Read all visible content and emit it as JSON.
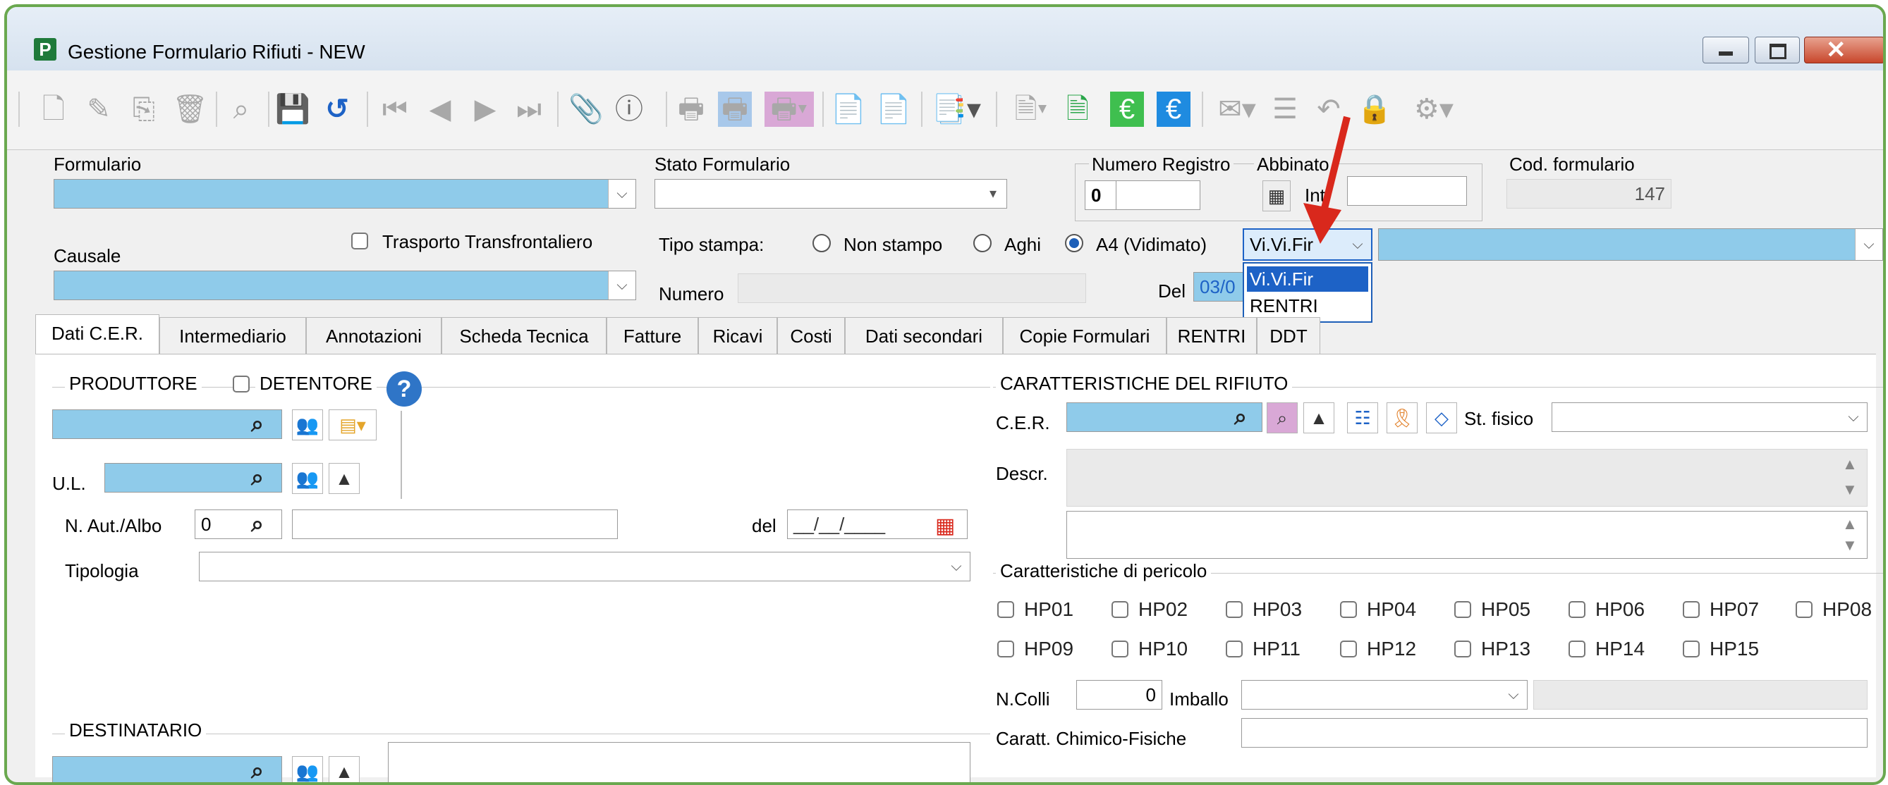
{
  "window": {
    "title": "Gestione Formulario Rifiuti - NEW",
    "app_icon_letter": "P"
  },
  "header": {
    "formulario_label": "Formulario",
    "stato_label": "Stato Formulario",
    "numero_registro_label": "Numero Registro",
    "numero_registro_value": "0",
    "abbinato_label": "Abbinato",
    "int_label": "Int",
    "cod_formulario_label": "Cod. formulario",
    "cod_formulario_value": "147",
    "causale_label": "Causale",
    "trasporto_label": "Trasporto Transfrontaliero",
    "tipo_stampa_label": "Tipo stampa:",
    "non_stampo_label": "Non stampo",
    "aghi_label": "Aghi",
    "a4_label": "A4 (Vidimato)",
    "format_selected": "Vi.Vi.Fir",
    "format_options": [
      "Vi.Vi.Fir",
      "RENTRI"
    ],
    "numero_label": "Numero",
    "del_label": "Del",
    "del_value": "03/0"
  },
  "tabs": [
    "Dati C.E.R.",
    "Intermediario",
    "Annotazioni",
    "Scheda Tecnica",
    "Fatture",
    "Ricavi",
    "Costi",
    "Dati secondari",
    "Copie Formulari",
    "RENTRI",
    "DDT"
  ],
  "produttore": {
    "title": "PRODUTTORE",
    "detentore_label": "DETENTORE",
    "ul_label": "U.L.",
    "naut_label": "N. Aut./Albo",
    "naut_value": "0",
    "del_label": "del",
    "date_placeholder": "__/__/____",
    "tipologia_label": "Tipologia"
  },
  "destinatario": {
    "title": "DESTINATARIO"
  },
  "caratteristiche": {
    "title": "CARATTERISTICHE DEL RIFIUTO",
    "cer_label": "C.E.R.",
    "st_fisico_label": "St. fisico",
    "descr_label": "Descr.",
    "pericolo_title": "Caratteristiche di pericolo",
    "hp_row1": [
      "HP01",
      "HP02",
      "HP03",
      "HP04",
      "HP05",
      "HP06",
      "HP07",
      "HP08"
    ],
    "hp_row2": [
      "HP09",
      "HP10",
      "HP11",
      "HP12",
      "HP13",
      "HP14",
      "HP15"
    ],
    "ncolli_label": "N.Colli",
    "ncolli_value": "0",
    "imballo_label": "Imballo",
    "chimico_label": "Caratt. Chimico-Fisiche"
  },
  "colors": {
    "accent_blue": "#8fcbea",
    "highlight_green": "#3fbf4f",
    "highlight_blue": "#1f8be0",
    "pink": "#d9a8d6",
    "arrow_red": "#d9281c"
  }
}
